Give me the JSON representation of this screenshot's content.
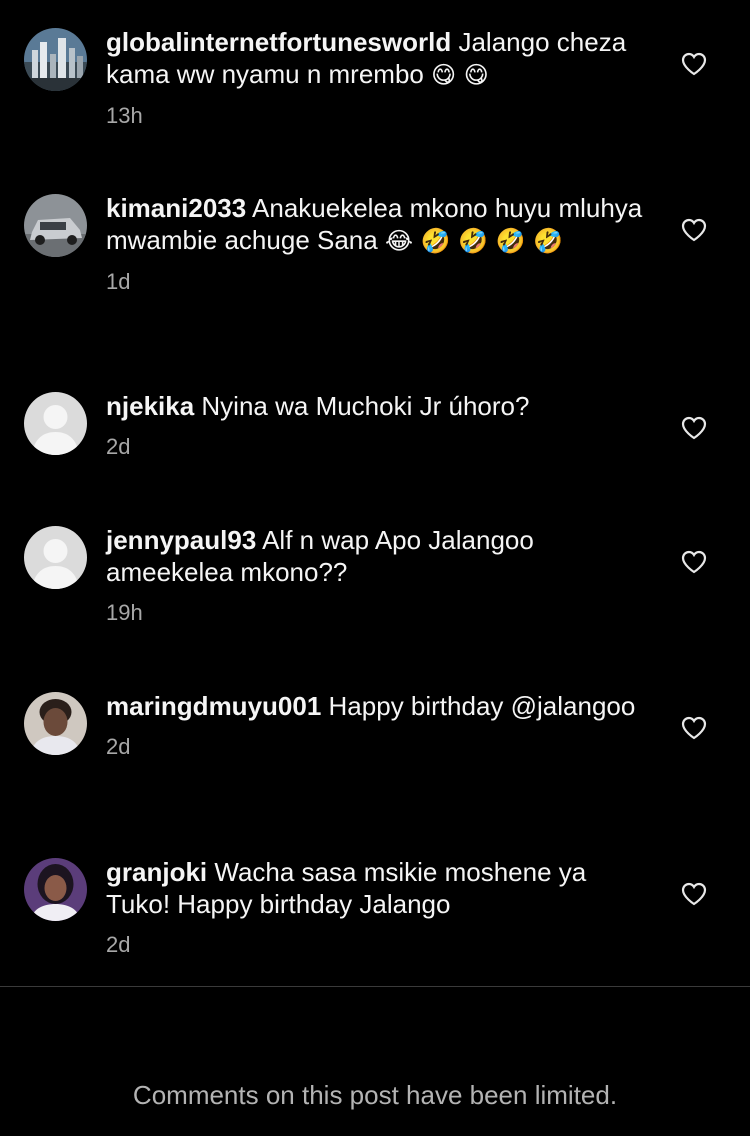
{
  "comments": [
    {
      "username": "globalinternetfortunesworld",
      "text": "Jalango cheza kama ww nyamu n mrembo",
      "emoji": "😋 😋",
      "time": "13h",
      "avatar": "city-skyline-photo"
    },
    {
      "username": "kimani2033",
      "text": "Anakuekelea mkono huyu mluhya  mwambie achuge Sana",
      "emoji": "😂 🤣 🤣 🤣 🤣",
      "time": "1d",
      "avatar": "car-photo"
    },
    {
      "username": "njekika",
      "text": "Nyina wa Muchoki Jr úhoro?",
      "emoji": "",
      "time": "2d",
      "avatar": "default-avatar"
    },
    {
      "username": "jennypaul93",
      "text": "Alf n wap Apo Jalangoo ameekelea mkono??",
      "emoji": "",
      "time": "19h",
      "avatar": "default-avatar"
    },
    {
      "username": "maringdmuyu001",
      "text": "Happy birthday @jalangoo",
      "emoji": "",
      "time": "2d",
      "avatar": "person-photo"
    },
    {
      "username": "granjoki",
      "text": "Wacha sasa msikie moshene ya Tuko! Happy birthday Jalango",
      "emoji": "",
      "time": "2d",
      "avatar": "person-photo-purple"
    }
  ],
  "footer": {
    "limited_text": "Comments on this post have been limited."
  },
  "colors": {
    "background": "#000000",
    "text": "#f5f5f5",
    "muted": "#a8a8a8",
    "divider": "#3a3a3a"
  }
}
